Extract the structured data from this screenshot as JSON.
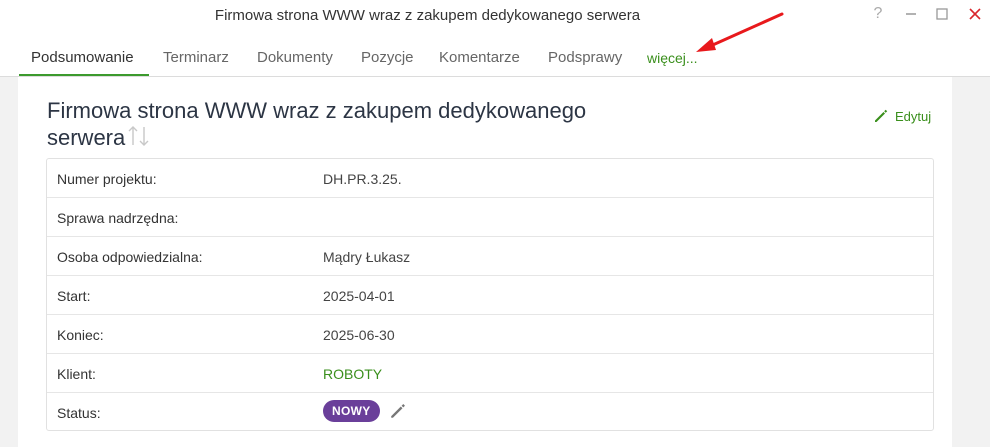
{
  "window": {
    "title": "Firmowa strona WWW wraz z zakupem dedykowanego serwera",
    "help_label": "?"
  },
  "tabs": [
    {
      "label": "Podsumowanie",
      "active": true
    },
    {
      "label": "Terminarz"
    },
    {
      "label": "Dokumenty"
    },
    {
      "label": "Pozycje"
    },
    {
      "label": "Komentarze"
    },
    {
      "label": "Podsprawy"
    }
  ],
  "more_tab": {
    "label": "więcej..."
  },
  "header": {
    "title": "Firmowa strona WWW wraz z zakupem dedykowanego serwera",
    "edit_label": "Edytuj"
  },
  "details": [
    {
      "label": "Numer projektu:",
      "value": "DH.PR.3.25."
    },
    {
      "label": "Sprawa nadrzędna:",
      "value": ""
    },
    {
      "label": "Osoba odpowiedzialna:",
      "value": "Mądry Łukasz"
    },
    {
      "label": "Start:",
      "value": "2025-04-01"
    },
    {
      "label": "Koniec:",
      "value": "2025-06-30"
    },
    {
      "label": "Klient:",
      "value": "ROBOTY"
    },
    {
      "label": "Status:",
      "value": "NOWY"
    }
  ],
  "colors": {
    "accent_green": "#3a8f1c",
    "status_badge": "#6a3f9a",
    "annotation_arrow": "#e8191c"
  }
}
